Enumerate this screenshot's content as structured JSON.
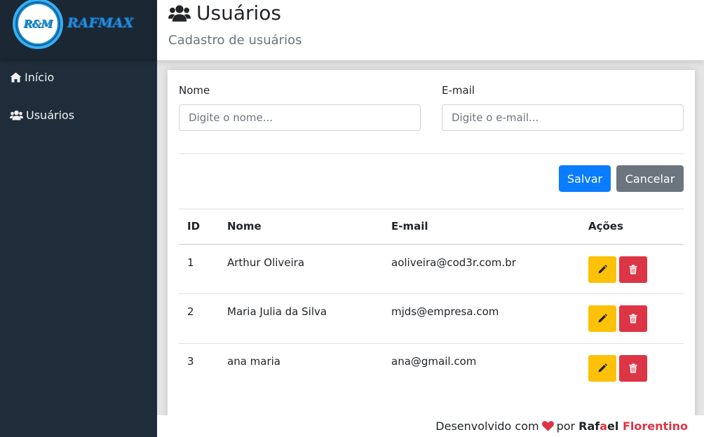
{
  "brand": {
    "logo_mark": "R&M",
    "logo_name": "RAFMAX"
  },
  "sidebar": {
    "items": [
      {
        "label": "Início",
        "icon": "home-icon"
      },
      {
        "label": "Usuários",
        "icon": "users-icon"
      }
    ]
  },
  "header": {
    "title": "Usuários",
    "subtitle": "Cadastro de usuários",
    "icon": "users-icon"
  },
  "form": {
    "nome_label": "Nome",
    "nome_placeholder": "Digite o nome...",
    "email_label": "E-mail",
    "email_placeholder": "Digite o e-mail...",
    "save_label": "Salvar",
    "cancel_label": "Cancelar"
  },
  "table": {
    "headers": [
      "ID",
      "Nome",
      "E-mail",
      "Ações"
    ],
    "rows": [
      {
        "id": "1",
        "nome": "Arthur Oliveira",
        "email": "aoliveira@cod3r.com.br"
      },
      {
        "id": "2",
        "nome": "Maria Julia da Silva",
        "email": "mjds@empresa.com"
      },
      {
        "id": "3",
        "nome": "ana maria",
        "email": "ana@gmail.com"
      }
    ]
  },
  "footer": {
    "prefix": "Desenvolvido com",
    "by": "por",
    "author_first_a": "Raf",
    "author_first_b": "a",
    "author_first_c": "el",
    "author_last": "Florentino"
  },
  "colors": {
    "sidebar_bg": "#1f2d3a",
    "primary": "#0a7cff",
    "secondary": "#6c757d",
    "warning": "#fdc107",
    "danger": "#dc3545"
  }
}
